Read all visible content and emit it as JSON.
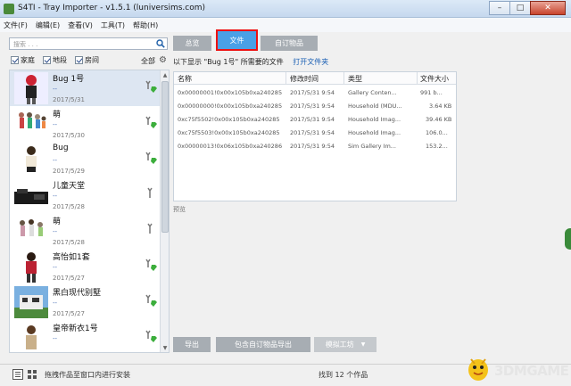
{
  "window": {
    "title": "S4TI - Tray Importer - v1.5.1  (luniversims.com)",
    "minimize_icon": "minimize-icon",
    "maximize_icon": "maximize-icon",
    "close_icon": "close-icon"
  },
  "menu": [
    "文件(F)",
    "编辑(E)",
    "查看(V)",
    "工具(T)",
    "帮助(H)"
  ],
  "sidebar": {
    "search_placeholder": "搜索 . . .",
    "filters": [
      "家庭",
      "地段",
      "房间"
    ],
    "all_label": "全部",
    "items": [
      {
        "name": "Bug 1号",
        "sub": "--",
        "date": "2017/5/31",
        "selected": true
      },
      {
        "name": "萌",
        "sub": "--",
        "date": "2017/5/30",
        "selected": false
      },
      {
        "name": "Bug",
        "sub": "--",
        "date": "2017/5/29",
        "selected": false
      },
      {
        "name": "儿童天堂",
        "sub": "--",
        "date": "2017/5/28",
        "selected": false
      },
      {
        "name": "萌",
        "sub": "--",
        "date": "2017/5/28",
        "selected": false
      },
      {
        "name": "高怡如1套",
        "sub": "--",
        "date": "2017/5/27",
        "selected": false
      },
      {
        "name": "黑白现代别墅",
        "sub": "--",
        "date": "2017/5/27",
        "selected": false
      },
      {
        "name": "皇帝新衣1号",
        "sub": "--",
        "date": "",
        "selected": false
      }
    ]
  },
  "tabs": [
    "总览",
    "文件",
    "自订物品"
  ],
  "active_tab": "文件",
  "info": {
    "text": "以下显示 \"Bug 1号\" 所需要的文件",
    "link": "打开文件夹"
  },
  "table": {
    "headers": [
      "名称",
      "修改时间",
      "类型",
      "文件大小"
    ],
    "rows": [
      [
        "0x00000001!0x00x105b0xa240285",
        "2017/5/31 9:54",
        "Gallery Conten...",
        "991 b..."
      ],
      [
        "0x00000000!0x00x105b0xa240285",
        "2017/5/31 9:54",
        "Household (MDU...",
        "3.64 KB"
      ],
      [
        "0xc75f5502!0x00x105b0xa240285",
        "2017/5/31 9:54",
        "Household Imag...",
        "39.46 KB"
      ],
      [
        "0xc75f5503!0x00x105b0xa240285",
        "2017/5/31 9:54",
        "Household Imag...",
        "106.0..."
      ],
      [
        "0x00000013!0x06x105b0xa240286",
        "2017/5/31 9:54",
        "Sim Gallery Im...",
        "153.2..."
      ]
    ]
  },
  "preview_label": "预览",
  "actions": {
    "export": "导出",
    "export_with_cc": "包含自订物品导出",
    "mod_workshop": "模拟工坊"
  },
  "status": {
    "hint": "拖拽作品至窗口内进行安装",
    "found": "找到 12 个作品"
  },
  "watermark": "3DMGAME",
  "colors": {
    "active_tab": "#4aa0e6",
    "highlight_border": "#ee1111",
    "gray_button": "#a7adb3",
    "link": "#1a5fb4"
  }
}
